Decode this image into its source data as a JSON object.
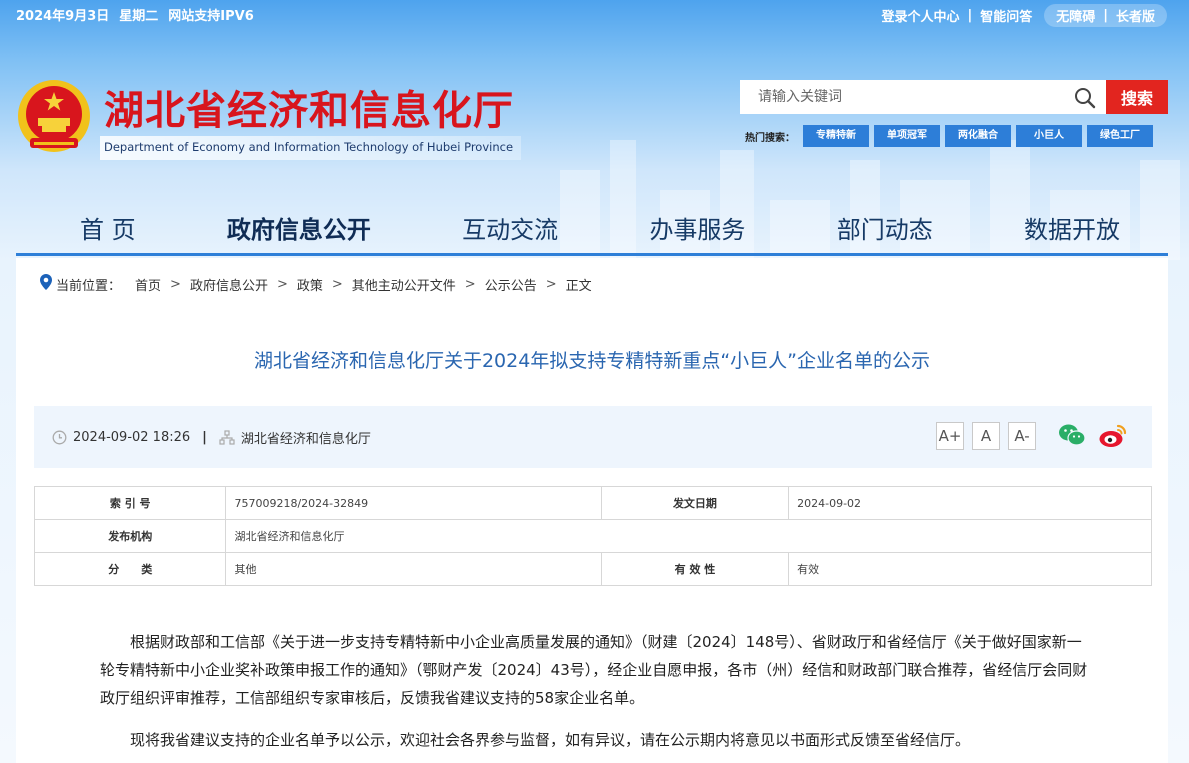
{
  "topbar": {
    "date": "2024年9月3日",
    "weekday": "星期二",
    "ipv6": "网站支持IPV6",
    "login": "登录个人中心",
    "qa": "智能问答",
    "accessible": "无障碍",
    "elder": "长者版"
  },
  "header": {
    "title": "湖北省经济和信息化厅",
    "subtitle": "Department of Economy and Information Technology of Hubei Province"
  },
  "search": {
    "placeholder": "请输入关键词",
    "button": "搜索",
    "hot_label": "热门搜索：",
    "hot_tags": [
      "专精特新",
      "单项冠军",
      "两化融合",
      "小巨人",
      "绿色工厂"
    ]
  },
  "nav": {
    "items": [
      "首 页",
      "政府信息公开",
      "互动交流",
      "办事服务",
      "部门动态",
      "数据开放"
    ],
    "active_index": 1
  },
  "breadcrumb": {
    "label": "当前位置：",
    "items": [
      "首页",
      "政府信息公开",
      "政策",
      "其他主动公开文件",
      "公示公告",
      "正文"
    ],
    "separator": ">"
  },
  "article": {
    "title": "湖北省经济和信息化厅关于2024年拟支持专精特新重点“小巨人”企业名单的公示",
    "datetime": "2024-09-02 18:26",
    "source": "湖北省经济和信息化厅",
    "font_sizes": [
      "A+",
      "A",
      "A-"
    ],
    "share_icons": [
      "wechat-icon",
      "weibo-icon"
    ]
  },
  "info_table": {
    "index_label": "索 引 号",
    "index_value": "757009218/2024-32849",
    "date_label": "发文日期",
    "date_value": "2024-09-02",
    "issuer_label": "发布机构",
    "issuer_value": "湖北省经济和信息化厅",
    "category_label": "分　　类",
    "category_value": "其他",
    "validity_label": "有 效 性",
    "validity_value": "有效"
  },
  "body": {
    "p1": "根据财政部和工信部《关于进一步支持专精特新中小企业高质量发展的通知》（财建〔2024〕148号）、省财政厅和省经信厅《关于做好国家新一轮专精特新中小企业奖补政策申报工作的通知》（鄂财产发〔2024〕43号），经企业自愿申报，各市（州）经信和财政部门联合推荐，省经信厅会同财政厅组织评审推荐，工信部组织专家审核后，反馈我省建议支持的58家企业名单。",
    "p2": "现将我省建议支持的企业名单予以公示，欢迎社会各界参与监督，如有异议，请在公示期内将意见以书面形式反馈至省经信厅。"
  },
  "colors": {
    "brand_red": "#d8151d",
    "nav_blue": "#2e7fd8",
    "title_blue": "#2a66b0",
    "meta_bg": "#eef5fd"
  }
}
